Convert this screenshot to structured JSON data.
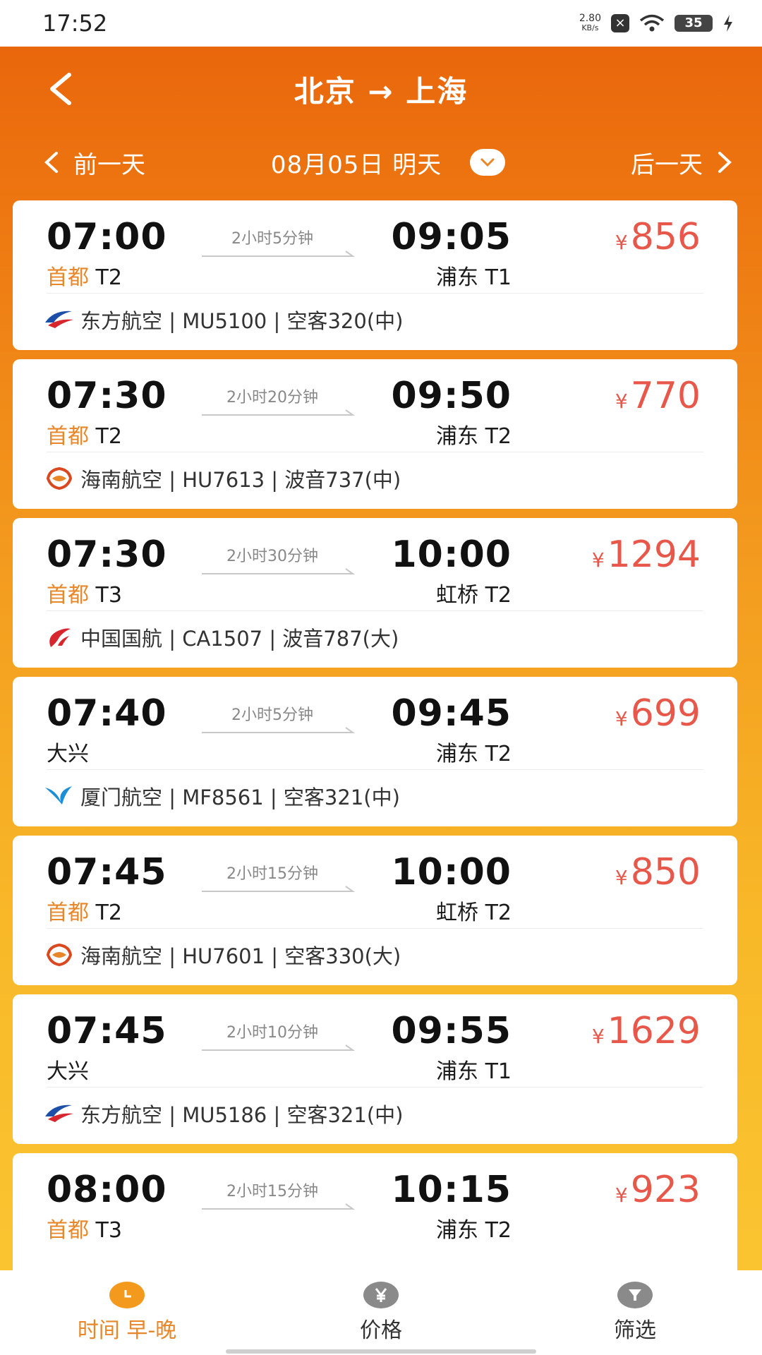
{
  "status": {
    "time": "17:52",
    "net_speed_value": "2.80",
    "net_speed_unit": "KB/s",
    "battery": "35"
  },
  "header": {
    "title": "北京 → 上海"
  },
  "date_bar": {
    "prev_label": "前一天",
    "date": "08月05日 明天",
    "next_label": "后一天"
  },
  "flights": [
    {
      "dep_time": "07:00",
      "duration": "2小时5分钟",
      "arr_time": "09:05",
      "price": "856",
      "dep_port": "首都",
      "dep_term": "T2",
      "arr_airport": "浦东 T1",
      "airline": "东方航空 | MU5100 | 空客320(中)",
      "logo": "china-eastern",
      "port_colored": true
    },
    {
      "dep_time": "07:30",
      "duration": "2小时20分钟",
      "arr_time": "09:50",
      "price": "770",
      "dep_port": "首都",
      "dep_term": "T2",
      "arr_airport": "浦东 T2",
      "airline": "海南航空 | HU7613 | 波音737(中)",
      "logo": "hainan",
      "port_colored": true
    },
    {
      "dep_time": "07:30",
      "duration": "2小时30分钟",
      "arr_time": "10:00",
      "price": "1294",
      "dep_port": "首都",
      "dep_term": "T3",
      "arr_airport": "虹桥 T2",
      "airline": "中国国航 | CA1507 | 波音787(大)",
      "logo": "air-china",
      "port_colored": true
    },
    {
      "dep_time": "07:40",
      "duration": "2小时5分钟",
      "arr_time": "09:45",
      "price": "699",
      "dep_port": "大兴",
      "dep_term": "",
      "arr_airport": "浦东 T2",
      "airline": "厦门航空 | MF8561 | 空客321(中)",
      "logo": "xiamen",
      "port_colored": false
    },
    {
      "dep_time": "07:45",
      "duration": "2小时15分钟",
      "arr_time": "10:00",
      "price": "850",
      "dep_port": "首都",
      "dep_term": "T2",
      "arr_airport": "虹桥 T2",
      "airline": "海南航空 | HU7601 | 空客330(大)",
      "logo": "hainan",
      "port_colored": true
    },
    {
      "dep_time": "07:45",
      "duration": "2小时10分钟",
      "arr_time": "09:55",
      "price": "1629",
      "dep_port": "大兴",
      "dep_term": "",
      "arr_airport": "浦东 T1",
      "airline": "东方航空 | MU5186 | 空客321(中)",
      "logo": "china-eastern",
      "port_colored": false
    },
    {
      "dep_time": "08:00",
      "duration": "2小时15分钟",
      "arr_time": "10:15",
      "price": "923",
      "dep_port": "首都",
      "dep_term": "T3",
      "arr_airport": "浦东 T2",
      "airline": "",
      "logo": "",
      "port_colored": true
    }
  ],
  "currency_symbol": "¥",
  "bottom_tabs": [
    {
      "label": "时间 早-晚",
      "icon": "clock-icon",
      "icon_color": "#F39A1E",
      "active": true
    },
    {
      "label": "价格",
      "icon": "yen-icon",
      "icon_color": "#8a8a8a",
      "active": false
    },
    {
      "label": "筛选",
      "icon": "filter-icon",
      "icon_color": "#8a8a8a",
      "active": false
    }
  ],
  "colors": {
    "accent_orange": "#E8872A",
    "price_red": "#E8584A",
    "header_orange": "#E8620A"
  }
}
